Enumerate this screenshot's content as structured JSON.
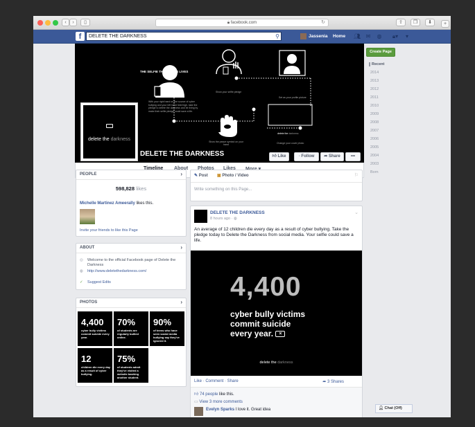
{
  "browser": {
    "url": "facebook.com",
    "colors": {
      "close": "#fc5f57",
      "minimize": "#fdbc40",
      "zoom": "#33c848"
    }
  },
  "fb_header": {
    "logo": "f",
    "search_value": "DELETE THE DARKNESS",
    "user_name": "Jassenia",
    "home_label": "Home",
    "brand_color": "#3b5998"
  },
  "cover": {
    "top_caption": "THE SELFIE THAT SAVES LIVES",
    "step_1": "Show your selfie pledge",
    "step_2": "Set as your profile picture",
    "step_3": "Change your cover photo",
    "step_4": "Show the peace symbol on your hand",
    "instructions": "With your right hand on the source of cyber bullying and your left hand held high, take the pledge to delete the darkness and be living by make their selfie pledge could save a life.",
    "mini_cover_text_1": "delete the",
    "mini_cover_text_2": "darkness"
  },
  "profile": {
    "pic_text_1": "delete the",
    "pic_text_2": "darkness",
    "page_name": "DELETE THE DARKNESS",
    "like_label": "Like",
    "follow_label": "Follow",
    "share_label": "Share",
    "more_label": "•••"
  },
  "tabs": [
    "Timeline",
    "About",
    "Photos",
    "Likes",
    "More ▾"
  ],
  "people": {
    "header": "PEOPLE",
    "count": "598,828",
    "count_suffix": "likes",
    "liker_name": "Michelle Martinez Ameerally",
    "liker_suffix": "likes this.",
    "invite_text": "Invite your friends to like this Page"
  },
  "about": {
    "header": "ABOUT",
    "description": "Welcome to the official Facebook page of Delete the Darkness",
    "website": "http://www.deletethedarkness.com/",
    "suggest": "Suggest Edits"
  },
  "photos": {
    "header": "PHOTOS",
    "items": [
      {
        "big": "4,400",
        "small": "cyber bully victims commit suicide every year."
      },
      {
        "big": "70%",
        "small": "of students are regularly bullied online."
      },
      {
        "big": "90%",
        "small": "of teens who have seen social media bullying say they've ignored it."
      },
      {
        "big": "12",
        "small": "children die every day as a result of cyber bullying."
      },
      {
        "big": "75%",
        "small": "of students admit they've visited a website bashing another student."
      }
    ]
  },
  "composer": {
    "post_label": "Post",
    "photo_label": "Photo / Video",
    "placeholder": "Write something on this Page..."
  },
  "post": {
    "page_name": "DELETE THE DARKNESS",
    "time": "8 hours ago",
    "text": "An average of 12 children die every day as a result of cyber bullying. Take the pledge today to Delete the Darkness from social media. Your selfie could save a life.",
    "image_big": "4,400",
    "image_line_1": "cyber bully victims",
    "image_line_2": "commit suicide",
    "image_line_3": "every year.",
    "image_footer_1": "delete the",
    "image_footer_2": "darkness",
    "actions": "Like · Comment · Share",
    "shares": "3 Shares",
    "likes_count": "74 people",
    "likes_suffix": "like this.",
    "more_comments": "View 3 more comments",
    "commenter": "Evelyn Sparks",
    "comment": "I love it. Great idea"
  },
  "rail": {
    "create_page": "Create Page",
    "years": [
      "Recent",
      "2014",
      "2013",
      "2012",
      "2011",
      "2010",
      "2009",
      "2008",
      "2007",
      "2006",
      "2005",
      "2004",
      "2003",
      "Born"
    ]
  },
  "chat": {
    "label": "Chat (Off)"
  }
}
